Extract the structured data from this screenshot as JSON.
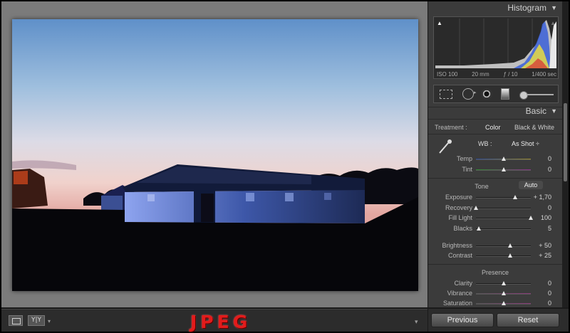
{
  "toolbar": {
    "compare_label": "Y|Y",
    "caret": "▾",
    "overlay_text": "JPEG",
    "right_caret": "▾"
  },
  "histogram": {
    "title": "Histogram",
    "iso": "ISO 100",
    "focal": "20 mm",
    "aperture": "ƒ / 10",
    "shutter": "1/400 sec",
    "clip_left": "▲",
    "clip_right": "▲"
  },
  "basic": {
    "title": "Basic",
    "treatment_label": "Treatment :",
    "treatment_color": "Color",
    "treatment_bw": "Black & White",
    "wb_label": "WB :",
    "wb_value": "As Shot ÷",
    "tone_label": "Tone",
    "auto_label": "Auto",
    "presence_label": "Presence"
  },
  "sliders": {
    "temp": {
      "label": "Temp",
      "value": "0",
      "level": 0.5
    },
    "tint": {
      "label": "Tint",
      "value": "0",
      "level": 0.5
    },
    "exposure": {
      "label": "Exposure",
      "value": "+ 1,70",
      "level": 0.71
    },
    "recovery": {
      "label": "Recovery",
      "value": "0",
      "level": 0.0
    },
    "fill": {
      "label": "Fill Light",
      "value": "100",
      "level": 1.0
    },
    "blacks": {
      "label": "Blacks",
      "value": "5",
      "level": 0.05
    },
    "brightness": {
      "label": "Brightness",
      "value": "+ 50",
      "level": 0.62
    },
    "contrast": {
      "label": "Contrast",
      "value": "+ 25",
      "level": 0.62
    },
    "clarity": {
      "label": "Clarity",
      "value": "0",
      "level": 0.5
    },
    "vibrance": {
      "label": "Vibrance",
      "value": "0",
      "level": 0.5
    },
    "saturation": {
      "label": "Saturation",
      "value": "0",
      "level": 0.5
    }
  },
  "buttons": {
    "previous": "Previous",
    "reset": "Reset"
  },
  "colors": {
    "panel": "#3b3b3b",
    "canvas": "#7b7b7b",
    "overlay_red": "#e31b1b"
  }
}
